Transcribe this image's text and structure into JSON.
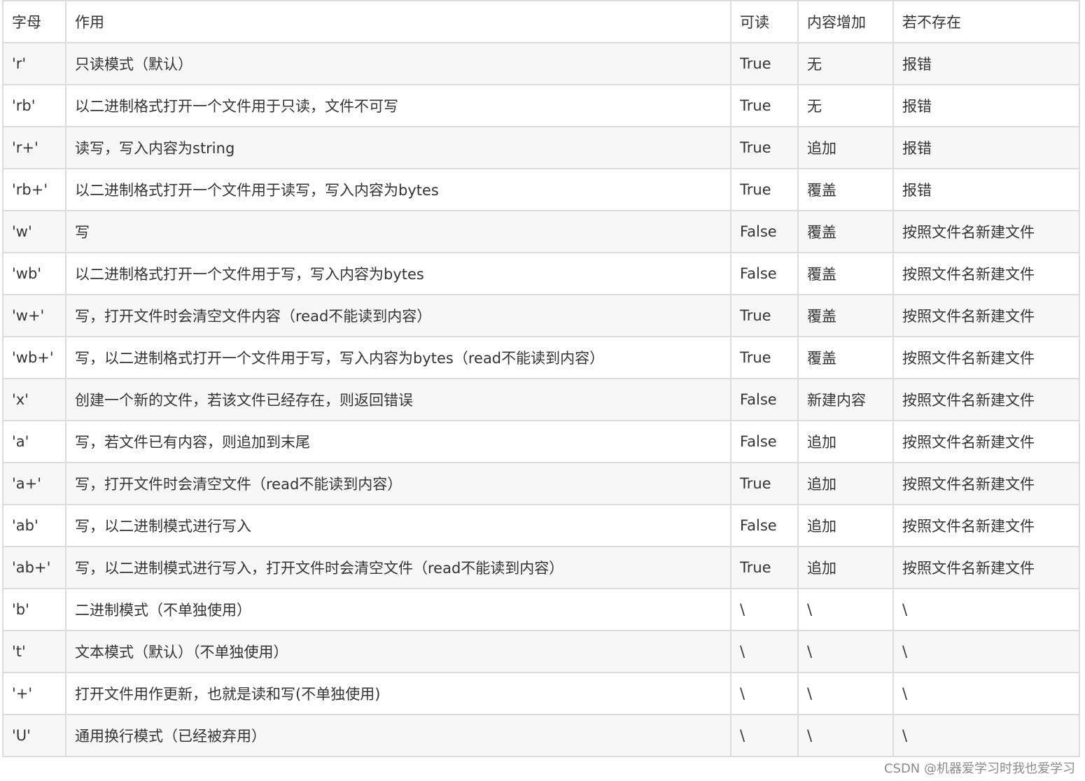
{
  "table": {
    "headers": [
      "字母",
      "作用",
      "可读",
      "内容增加",
      "若不存在"
    ],
    "rows": [
      [
        "'r'",
        "只读模式（默认）",
        "True",
        "无",
        "报错"
      ],
      [
        "'rb'",
        "以二进制格式打开一个文件用于只读，文件不可写",
        "True",
        "无",
        "报错"
      ],
      [
        "'r+'",
        "读写，写入内容为string",
        "True",
        "追加",
        "报错"
      ],
      [
        "'rb+'",
        "以二进制格式打开一个文件用于读写，写入内容为bytes",
        "True",
        "覆盖",
        "报错"
      ],
      [
        "'w'",
        "写",
        "False",
        "覆盖",
        "按照文件名新建文件"
      ],
      [
        "'wb'",
        "以二进制格式打开一个文件用于写，写入内容为bytes",
        "False",
        "覆盖",
        "按照文件名新建文件"
      ],
      [
        "'w+'",
        "写，打开文件时会清空文件内容（read不能读到内容）",
        "True",
        "覆盖",
        "按照文件名新建文件"
      ],
      [
        "'wb+'",
        "写，以二进制格式打开一个文件用于写，写入内容为bytes（read不能读到内容）",
        "True",
        "覆盖",
        "按照文件名新建文件"
      ],
      [
        "'x'",
        "创建一个新的文件，若该文件已经存在，则返回错误",
        "False",
        "新建内容",
        "按照文件名新建文件"
      ],
      [
        "'a'",
        "写，若文件已有内容，则追加到末尾",
        "False",
        "追加",
        "按照文件名新建文件"
      ],
      [
        "'a+'",
        "写，打开文件时会清空文件（read不能读到内容）",
        "True",
        "追加",
        "按照文件名新建文件"
      ],
      [
        "'ab'",
        "写，以二进制模式进行写入",
        "False",
        "追加",
        "按照文件名新建文件"
      ],
      [
        "'ab+'",
        "写，以二进制模式进行写入，打开文件时会清空文件（read不能读到内容）",
        "True",
        "追加",
        "按照文件名新建文件"
      ],
      [
        "'b'",
        "二进制模式（不单独使用）",
        "\\",
        "\\",
        "\\"
      ],
      [
        "'t'",
        "文本模式（默认）（不单独使用）",
        "\\",
        "\\",
        "\\"
      ],
      [
        "'+'",
        "打开文件用作更新，也就是读和写(不单独使用)",
        "\\",
        "\\",
        "\\"
      ],
      [
        "'U'",
        "通用换行模式（已经被弃用）",
        "\\",
        "\\",
        "\\"
      ]
    ]
  },
  "watermark": "CSDN @机器爱学习时我也爱学习"
}
